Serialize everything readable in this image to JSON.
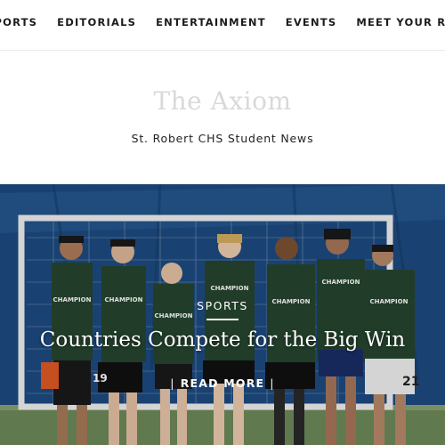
{
  "nav": {
    "items": [
      {
        "label": "SPORTS"
      },
      {
        "label": "EDITORIALS"
      },
      {
        "label": "ENTERTAINMENT"
      },
      {
        "label": "EVENTS"
      },
      {
        "label": "MEET YOUR REPORTERS"
      }
    ]
  },
  "masthead": {
    "title": "The Axiom",
    "tagline": "St. Robert CHS Student News"
  },
  "hero": {
    "category": "SPORTS",
    "headline": "Countries Compete for the Big Win",
    "read_more": "READ MORE",
    "jersey_text": "CHAMPION",
    "jersey_numbers": [
      "19",
      "21"
    ]
  }
}
